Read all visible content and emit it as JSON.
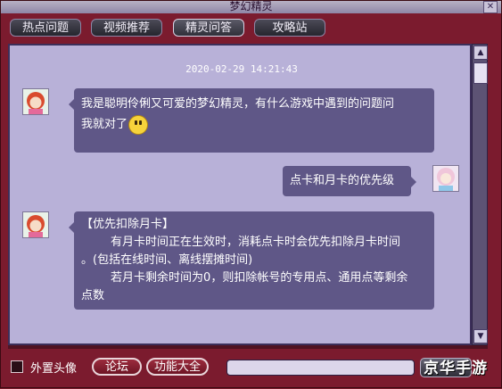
{
  "window": {
    "title": "梦幻精灵"
  },
  "tabs": [
    {
      "label": "热点问题"
    },
    {
      "label": "视频推荐"
    },
    {
      "label": "精灵问答"
    },
    {
      "label": "攻略站"
    }
  ],
  "chat": {
    "timestamp": "2020-02-29 14:21:43",
    "messages": [
      {
        "sender": "bot",
        "line1": "我是聪明伶俐又可爱的梦幻精灵，有什么游戏中遇到的问题问",
        "line2": "我就对了"
      },
      {
        "sender": "user",
        "text": "点卡和月卡的优先级"
      },
      {
        "sender": "bot",
        "lines": [
          "【优先扣除月卡】",
          "        有月卡时间正在生效时，消耗点卡时会优先扣除月卡时间",
          "。(包括在线时间、离线摆摊时间)",
          "        若月卡剩余时间为0，则扣除帐号的专用点、通用点等剩余",
          "点数"
        ]
      }
    ]
  },
  "bottom": {
    "checkbox_label": "外置头像",
    "forum_button": "论坛",
    "features_button": "功能大全",
    "input_value": ""
  },
  "watermark": "京华手游",
  "colors": {
    "frame": "#7b1b2e",
    "panel": "#b8b1d8",
    "bubble": "#5f5787"
  }
}
